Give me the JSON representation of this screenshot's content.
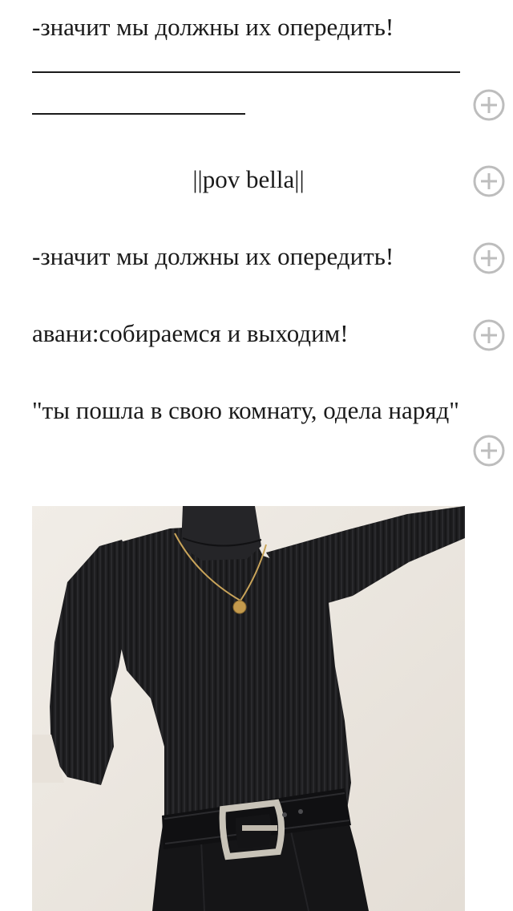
{
  "story": {
    "paragraphs": [
      "-значит мы должны их опередить!",
      "||pov bella||",
      "-значит мы должны их опередить!",
      "авани:собираемся и выходим!",
      "\"ты пошла в свою комнату, одела наряд\""
    ],
    "divider": "____________________________________________"
  },
  "icons": {
    "comment_add": "plus-circle-icon"
  },
  "image": {
    "subject": "black ribbed turtleneck sweater with gold coin pendant necklace, black leather belt with silver buckle, black jeans"
  },
  "colors": {
    "text": "#1a1a1a",
    "icon": "#bdbdbd",
    "background": "#ffffff",
    "sweater": "#1c1c1e"
  }
}
